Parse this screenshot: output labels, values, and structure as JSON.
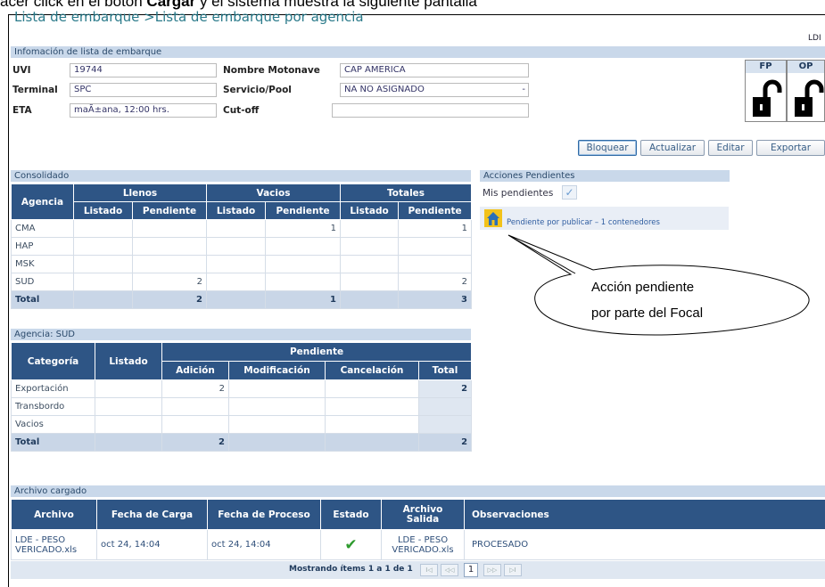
{
  "caption": "acer click en el botón Cargar y el sistema muestra la siguiente pantalla",
  "header": {
    "breadcrumb": "Lista de embarque >Lista de embarque por agencia",
    "user": "LDI"
  },
  "info": {
    "section_title": "Infomación de lista de embarque",
    "uvi_label": "UVI",
    "uvi_value": "19744",
    "terminal_label": "Terminal",
    "terminal_value": "SPC",
    "eta_label": "ETA",
    "eta_value": "maÃ±ana, 12:00 hrs.",
    "motonave_label": "Nombre Motonave",
    "motonave_value": "CAP AMERICA",
    "servicio_label": "Servicio/Pool",
    "servicio_value": "NA  NO ASIGNADO",
    "servicio_suffix": "-",
    "cutoff_label": "Cut-off",
    "cutoff_value": "",
    "fp_label": "FP",
    "op_label": "OP"
  },
  "toolbar": {
    "bloquear": "Bloquear",
    "actualizar": "Actualizar",
    "editar": "Editar",
    "exportar": "Exportar"
  },
  "consolidado": {
    "title": "Consolidado",
    "col_agencia": "Agencia",
    "groups": [
      "Llenos",
      "Vacios",
      "Totales"
    ],
    "sub": [
      "Listado",
      "Pendiente",
      "Listado",
      "Pendiente",
      "Listado",
      "Pendiente"
    ],
    "rows": [
      {
        "agencia": "CMA",
        "c": [
          "",
          "",
          "",
          "1",
          "",
          "1"
        ]
      },
      {
        "agencia": "HAP",
        "c": [
          "",
          "",
          "",
          "",
          "",
          ""
        ]
      },
      {
        "agencia": "MSK",
        "c": [
          "",
          "",
          "",
          "",
          "",
          ""
        ]
      },
      {
        "agencia": "SUD",
        "c": [
          "",
          "2",
          "",
          "",
          "",
          "2"
        ]
      }
    ],
    "total": {
      "agencia": "Total",
      "c": [
        "",
        "2",
        "",
        "1",
        "",
        "3"
      ]
    }
  },
  "acciones": {
    "title": "Acciones Pendientes",
    "mis_pendientes": "Mis pendientes",
    "item": "Pendiente por publicar – 1 contenedores"
  },
  "callout": {
    "line1": "Acción pendiente",
    "line2": "por parte del Focal"
  },
  "agencia": {
    "title": "Agencia: SUD",
    "col_categoria": "Categoría",
    "col_listado": "Listado",
    "group_pendiente": "Pendiente",
    "sub": [
      "Adición",
      "Modificación",
      "Cancelación",
      "Total"
    ],
    "rows": [
      {
        "categoria": "Exportación",
        "listado": "",
        "c": [
          "2",
          "",
          "",
          "2"
        ]
      },
      {
        "categoria": "Transbordo",
        "listado": "",
        "c": [
          "",
          "",
          "",
          ""
        ]
      },
      {
        "categoria": "Vacios",
        "listado": "",
        "c": [
          "",
          "",
          "",
          ""
        ]
      }
    ],
    "total": {
      "categoria": "Total",
      "listado": "",
      "c": [
        "2",
        "",
        "",
        "2"
      ]
    }
  },
  "archivo": {
    "title": "Archivo cargado",
    "cols": [
      "Archivo",
      "Fecha de Carga",
      "Fecha de Proceso",
      "Estado",
      "Archivo Salida",
      "Observaciones"
    ],
    "row": {
      "archivo": "LDE - PESO VERICADO.xls",
      "fecha_carga": "oct 24, 14:04",
      "fecha_proceso": "oct 24, 14:04",
      "estado": "ok",
      "salida": "LDE - PESO VERICADO.xls",
      "obs": "PROCESADO"
    },
    "footer": "Mostrando ítems 1 a 1 de 1",
    "page": "1"
  },
  "colors": {
    "header": "#2e5585",
    "section": "#c9d8ea",
    "accent": "#2a7a8a"
  }
}
